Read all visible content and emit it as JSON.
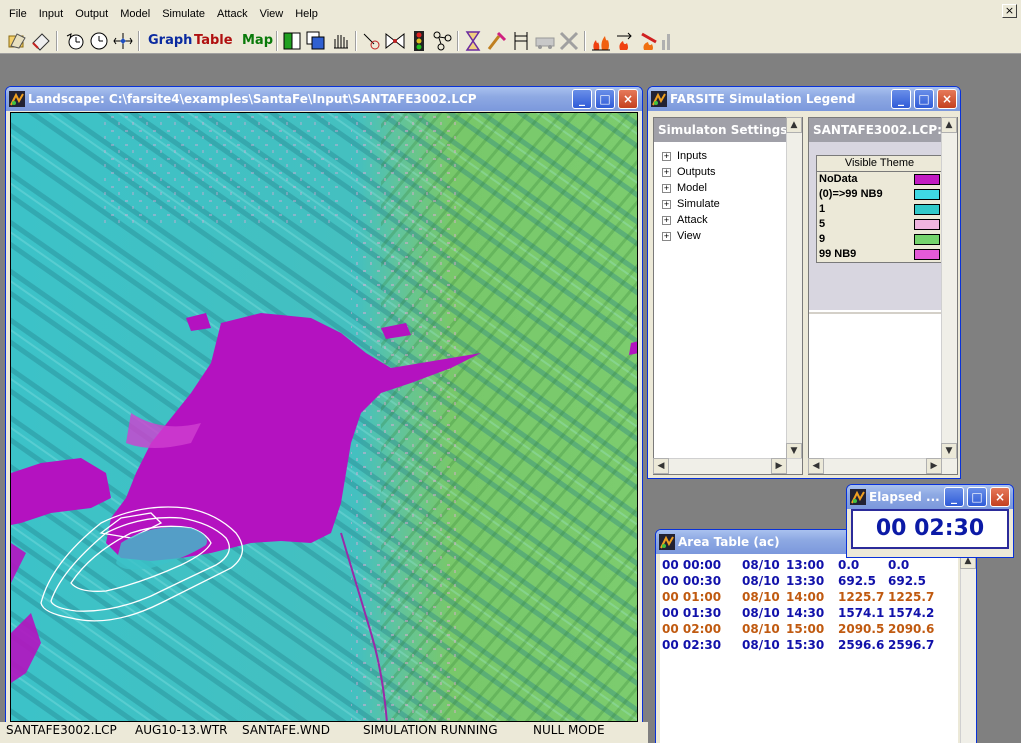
{
  "menu": {
    "items": [
      {
        "label": "File",
        "accel": "F"
      },
      {
        "label": "Input",
        "accel": "I"
      },
      {
        "label": "Output",
        "accel": "O"
      },
      {
        "label": "Model",
        "accel": "M"
      },
      {
        "label": "Simulate",
        "accel": "S"
      },
      {
        "label": "Attack",
        "accel": "A"
      },
      {
        "label": "View",
        "accel": "V"
      },
      {
        "label": "Help",
        "accel": "H"
      }
    ]
  },
  "toolbar": {
    "graph_label": "Graph",
    "table_label": "Table",
    "map_label": "Map",
    "icons": [
      "open-project-icon",
      "eraser-icon",
      "clock-reset-icon",
      "clock-icon",
      "compass-icon",
      "color-tools-icon",
      "bowtie-icon",
      "traffic-light-icon",
      "nodes-icon",
      "hourglass-icon",
      "brush-icon",
      "chair-icon",
      "fire-engine-icon",
      "tools-icon",
      "fires-icon",
      "burning-arrows-icon",
      "fire-spray-icon",
      "bars-icon"
    ]
  },
  "landscape_window": {
    "title": "Landscape: C:\\farsite4\\examples\\SantaFe\\Input\\SANTAFE3002.LCP"
  },
  "legend_window": {
    "title": "FARSITE Simulation Legend",
    "settings_pane": {
      "title": "Simulaton Settings",
      "tree": [
        "Inputs",
        "Outputs",
        "Model",
        "Simulate",
        "Attack",
        "View"
      ]
    },
    "theme_pane": {
      "title": "SANTAFE3002.LCP:",
      "header": "Visible Theme",
      "entries": [
        {
          "label": "NoData",
          "color": "#c21cc2"
        },
        {
          "label": "(0)=>99 NB9",
          "color": "#3fd8e4"
        },
        {
          "label": "1",
          "color": "#31c9c9"
        },
        {
          "label": "5",
          "color": "#f0b4e0"
        },
        {
          "label": "9",
          "color": "#74d46c"
        },
        {
          "label": "99 NB9",
          "color": "#e45ad8"
        }
      ]
    }
  },
  "area_window": {
    "title": "Area Table (ac)",
    "rows": [
      {
        "elapsed": "00 00:00",
        "date": "08/10",
        "time": "13:00",
        "a": "0.0",
        "b": "0.0",
        "color": "#1111aa"
      },
      {
        "elapsed": "00 00:30",
        "date": "08/10",
        "time": "13:30",
        "a": "692.5",
        "b": "692.5",
        "color": "#1111aa"
      },
      {
        "elapsed": "00 01:00",
        "date": "08/10",
        "time": "14:00",
        "a": "1225.7",
        "b": "1225.7",
        "color": "#c05a10"
      },
      {
        "elapsed": "00 01:30",
        "date": "08/10",
        "time": "14:30",
        "a": "1574.1",
        "b": "1574.2",
        "color": "#1111aa"
      },
      {
        "elapsed": "00 02:00",
        "date": "08/10",
        "time": "15:00",
        "a": "2090.5",
        "b": "2090.6",
        "color": "#c05a10"
      },
      {
        "elapsed": "00 02:30",
        "date": "08/10",
        "time": "15:30",
        "a": "2596.6",
        "b": "2596.7",
        "color": "#1111aa"
      }
    ]
  },
  "elapsed_window": {
    "title": "Elapsed ...",
    "value": "00 02:30"
  },
  "status_bar": {
    "fields": [
      "SANTAFE3002.LCP",
      "AUG10-13.WTR",
      "SANTAFE.WND",
      "SIMULATION RUNNING",
      "NULL MODE"
    ]
  },
  "colors": {
    "map_cyan": "#3cc2c8",
    "map_green": "#78c86a",
    "map_magenta": "#b412c0",
    "map_pink": "#e8a8d8"
  }
}
